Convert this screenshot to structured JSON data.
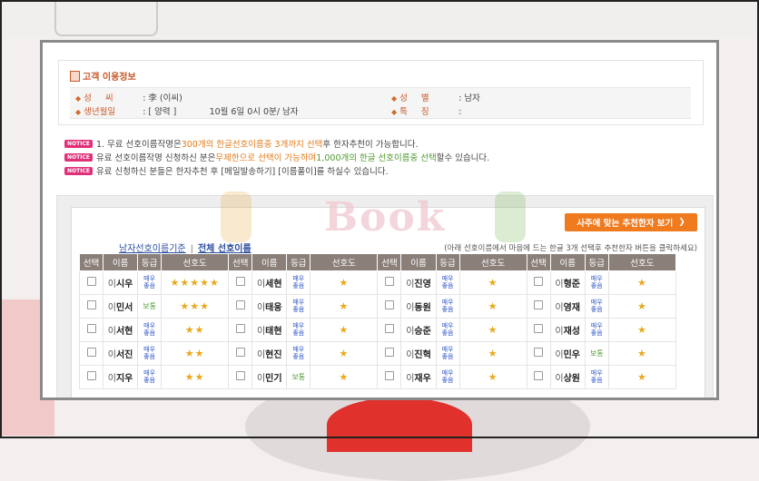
{
  "customer_info": {
    "heading": "고객 이용정보",
    "surname_label": "성 씨",
    "surname_value": ": 李 (이씨)",
    "gender_label": "성 별",
    "gender_value": ": 남자",
    "birth_label": "생년월일",
    "birth_value": ": [ 양력 ]            10월 6일 0시 0분/ 남자",
    "special_label": "특 징",
    "special_value": ":"
  },
  "notices": [
    {
      "tag": "NOTICE",
      "parts": [
        {
          "text": "1. 무료 선호이름작명은 ",
          "style": ""
        },
        {
          "text": "300개의 한글선호이름중 3개까지 선택",
          "style": "hl-orange"
        },
        {
          "text": "후 한자추천이 가능합니다.",
          "style": ""
        }
      ]
    },
    {
      "tag": "NOTICE",
      "parts": [
        {
          "text": "유료 선호이름작명 신청하신 분은",
          "style": ""
        },
        {
          "text": "무제한으로 선택이 가능하며 ",
          "style": "hl-orange"
        },
        {
          "text": "1,000개의 한글 선호이름중 선택",
          "style": "hl-green"
        },
        {
          "text": "할수 있습니다.",
          "style": ""
        }
      ]
    },
    {
      "tag": "NOTICE",
      "parts": [
        {
          "text": "유료 신청하신 분들은 한자추천 후 [메일발송하기] [이름풀이]를 하실수 있습니다.",
          "style": ""
        }
      ]
    }
  ],
  "watermark": "Book",
  "recommend_button": "사주에 맞는 추천한자 보기",
  "tabs": [
    {
      "label": "남자선호이름기준",
      "active": false
    },
    {
      "label": "전체 선호이름",
      "active": true
    }
  ],
  "help_text": "(아래 선호이름에서 마음에 드는 한글 3개 선택후 추천한자 버튼을 클릭하세요)",
  "columns": [
    "선택",
    "이름",
    "등급",
    "선호도"
  ],
  "grade_labels": {
    "vg": "매우좋음",
    "ok": "보통"
  },
  "rows": [
    [
      {
        "surname": "이",
        "given": "시우",
        "grade": "vg",
        "stars": 5
      },
      {
        "surname": "이",
        "given": "세현",
        "grade": "vg",
        "stars": 1
      },
      {
        "surname": "이",
        "given": "진영",
        "grade": "vg",
        "stars": 1
      },
      {
        "surname": "이",
        "given": "형준",
        "grade": "vg",
        "stars": 1
      }
    ],
    [
      {
        "surname": "이",
        "given": "민서",
        "grade": "ok",
        "stars": 3
      },
      {
        "surname": "이",
        "given": "태웅",
        "grade": "vg",
        "stars": 1
      },
      {
        "surname": "이",
        "given": "동원",
        "grade": "vg",
        "stars": 1
      },
      {
        "surname": "이",
        "given": "영재",
        "grade": "vg",
        "stars": 1
      }
    ],
    [
      {
        "surname": "이",
        "given": "서현",
        "grade": "vg",
        "stars": 2
      },
      {
        "surname": "이",
        "given": "태현",
        "grade": "vg",
        "stars": 1
      },
      {
        "surname": "이",
        "given": "승준",
        "grade": "vg",
        "stars": 1
      },
      {
        "surname": "이",
        "given": "재성",
        "grade": "vg",
        "stars": 1
      }
    ],
    [
      {
        "surname": "이",
        "given": "서진",
        "grade": "vg",
        "stars": 2
      },
      {
        "surname": "이",
        "given": "현진",
        "grade": "vg",
        "stars": 1
      },
      {
        "surname": "이",
        "given": "진혁",
        "grade": "vg",
        "stars": 1
      },
      {
        "surname": "이",
        "given": "민우",
        "grade": "ok",
        "stars": 1
      }
    ],
    [
      {
        "surname": "이",
        "given": "지우",
        "grade": "vg",
        "stars": 2
      },
      {
        "surname": "이",
        "given": "민기",
        "grade": "ok",
        "stars": 1
      },
      {
        "surname": "이",
        "given": "재우",
        "grade": "vg",
        "stars": 1
      },
      {
        "surname": "이",
        "given": "상원",
        "grade": "vg",
        "stars": 1
      }
    ]
  ]
}
